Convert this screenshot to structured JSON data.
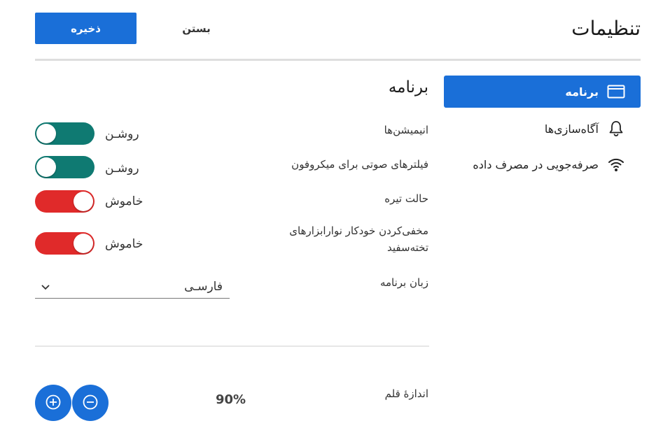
{
  "header": {
    "title": "تنظیمات",
    "save_label": "ذخیره",
    "close_label": "بستن"
  },
  "sidebar": {
    "items": [
      {
        "label": "برنامه",
        "icon": "window-icon",
        "active": true
      },
      {
        "label": "آگاه‌سازی‌ها",
        "icon": "bell-icon",
        "active": false
      },
      {
        "label": "صرفه‌جویی در مصرف داده",
        "icon": "wifi-icon",
        "active": false
      }
    ]
  },
  "section": {
    "title": "برنامه",
    "settings": [
      {
        "label": "انیمیشن‌ها",
        "state": "روشـن",
        "on": true
      },
      {
        "label": "فیلترهای صوتی برای میکروفون",
        "state": "روشـن",
        "on": true
      },
      {
        "label": "حالت تیره",
        "state": "خاموش",
        "on": false
      },
      {
        "label": "مخفی‌کردن خودکار نوارابزارهای تخته‌سفید",
        "state": "خاموش",
        "on": false
      }
    ],
    "language": {
      "label": "زبان برنامه",
      "value": "فارسـی"
    },
    "font_size": {
      "label": "اندازهٔ قلم",
      "value": "90%"
    }
  },
  "colors": {
    "accent": "#1a6fd8",
    "toggle_on": "#0f7a72",
    "toggle_off": "#e02a2a"
  }
}
